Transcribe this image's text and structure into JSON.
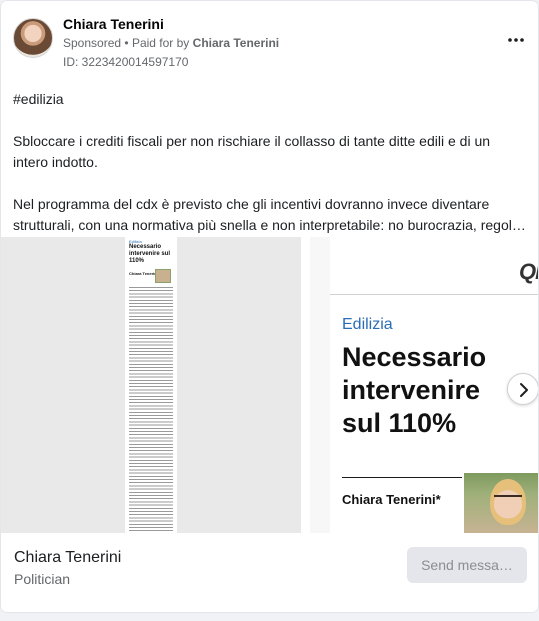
{
  "ad": {
    "advertiser_name": "Chiara Tenerini",
    "sponsored_label": "Sponsored",
    "separator": "•",
    "paid_for_by_label": "Paid for by",
    "paid_for_by_name": "Chiara Tenerini",
    "ad_id": "ID: 3223420014597170",
    "more_icon": "more-horizontal-icon"
  },
  "post": {
    "hashtag": "#edilizia",
    "paragraph1": "Sbloccare i crediti fiscali per non rischiare il collasso di tante ditte edili e di un intero indotto.",
    "paragraph2": "Nel programma del cdx è previsto che gli incentivi dovranno invece diventare strutturali, con una normativa più snella e non interpretabile: no burocrazia, regol…"
  },
  "carousel": {
    "slide1": {
      "mini_category": "Edilizia",
      "mini_title": "Necessario intervenire sul 110%",
      "mini_author": "Chiara Tenerini"
    },
    "slide2": {
      "logo": "QN",
      "category": "Edilizia",
      "headline": "Necessario intervenire sul 110%",
      "author": "Chiara Tenerini*"
    },
    "next_icon": "chevron-right-icon"
  },
  "footer": {
    "name": "Chiara Tenerini",
    "role": "Politician",
    "send_button": "Send messa…"
  }
}
